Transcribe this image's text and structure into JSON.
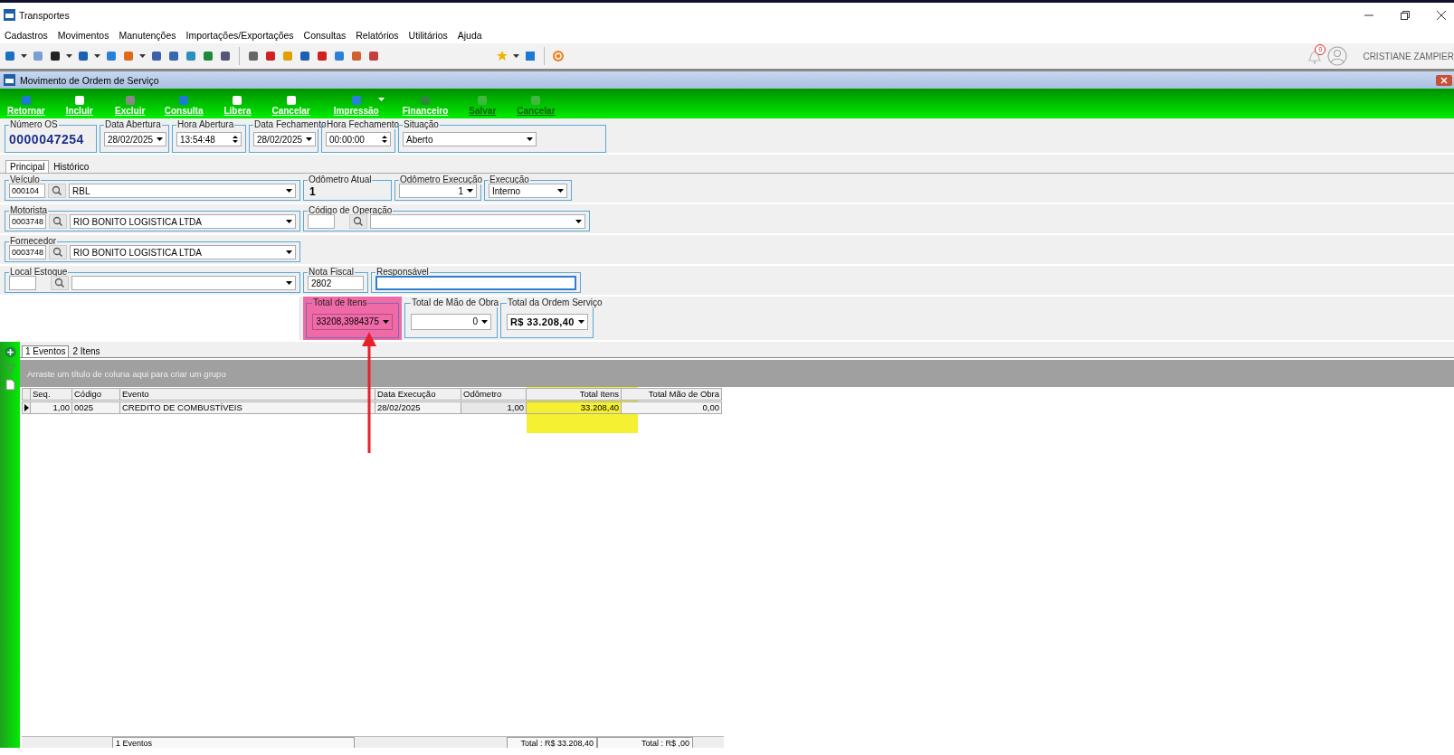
{
  "window": {
    "title": "Transportes"
  },
  "menu": [
    {
      "label": "Cadastros"
    },
    {
      "label": "Movimentos"
    },
    {
      "label": "Manutenções"
    },
    {
      "label": "Importações/Exportações"
    },
    {
      "label": "Consultas"
    },
    {
      "label": "Relatórios"
    },
    {
      "label": "Utilitários"
    },
    {
      "label": "Ajuda"
    }
  ],
  "user": {
    "name": "CRISTIANE ZAMPIER",
    "notifications": "0"
  },
  "form": {
    "title": "Movimento de Ordem de Serviço",
    "actions": [
      {
        "label": "Retornar",
        "disabled": false,
        "dropdown": false
      },
      {
        "label": "Incluir",
        "disabled": false,
        "dropdown": false
      },
      {
        "label": "Excluir",
        "disabled": false,
        "dropdown": false
      },
      {
        "label": "Consulta",
        "disabled": false,
        "dropdown": false
      },
      {
        "label": "Libera",
        "disabled": false,
        "dropdown": false
      },
      {
        "label": "Cancelar",
        "disabled": false,
        "dropdown": false
      },
      {
        "label": "Impressão",
        "disabled": false,
        "dropdown": true
      },
      {
        "label": "Financeiro",
        "disabled": false,
        "dropdown": false
      },
      {
        "label": "Salvar",
        "disabled": true,
        "dropdown": false
      },
      {
        "label": "Cancelar",
        "disabled": true,
        "dropdown": false
      }
    ],
    "header": [
      {
        "label": "Número OS",
        "value": "0000047254",
        "kind": "number"
      },
      {
        "label": "Data Abertura",
        "value": "28/02/2025",
        "kind": "date"
      },
      {
        "label": "Hora Abertura",
        "value": "13:54:48",
        "kind": "time"
      },
      {
        "label": "Data Fechamento",
        "value": "28/02/2025",
        "kind": "date"
      },
      {
        "label": "Hora Fechamento",
        "value": "00:00:00",
        "kind": "time"
      },
      {
        "label": "Situação",
        "value": "Aberto",
        "kind": "select"
      }
    ],
    "tabs": [
      {
        "label": "Principal",
        "selected": true
      },
      {
        "label": "Histórico",
        "selected": false
      }
    ],
    "veiculo": {
      "label": "Veículo",
      "code": "000104",
      "name": "RBL"
    },
    "odometro_atual": {
      "label": "Odômetro Atual",
      "value": "1"
    },
    "odometro_execucao": {
      "label": "Odômetro Execução",
      "value": "1"
    },
    "execucao": {
      "label": "Execução",
      "value": "Interno"
    },
    "motorista": {
      "label": "Motorista",
      "code": "0003748",
      "name": "RIO BONITO LOGISTICA LTDA"
    },
    "codigo_operacao": {
      "label": "Código de Operação"
    },
    "fornecedor": {
      "label": "Fornecedor",
      "code": "0003748",
      "name": "RIO BONITO LOGISTICA LTDA"
    },
    "local_estoque": {
      "label": "Local Estoque"
    },
    "nota_fiscal": {
      "label": "Nota Fiscal",
      "value": "2802"
    },
    "responsavel": {
      "label": "Responsável"
    },
    "totals": [
      {
        "label": "Total de Itens",
        "value": "33208,3984375",
        "kind": "plain"
      },
      {
        "label": "Total de Mão de Obra",
        "value": "0",
        "kind": "plain"
      },
      {
        "label": "Total da Ordem Serviço",
        "value": "R$ 33.208,40",
        "kind": "bold"
      }
    ],
    "grid_tabs": [
      {
        "label": "1 Eventos",
        "selected": true
      },
      {
        "label": "2 Itens",
        "selected": false
      }
    ],
    "group_panel": "Arraste um título de coluna aqui para criar um grupo",
    "columns": [
      {
        "label": "Seq."
      },
      {
        "label": "Código"
      },
      {
        "label": "Evento"
      },
      {
        "label": "Data Execução"
      },
      {
        "label": "Odômetro"
      },
      {
        "label": "Total Itens"
      },
      {
        "label": "Total Mão de Obra"
      }
    ],
    "rows": [
      {
        "cells": [
          "1,00",
          "0025",
          "CREDITO DE COMBUSTÍVEIS",
          "28/02/2025",
          "1,00",
          "33.208,40",
          "0,00"
        ],
        "selected": true
      }
    ],
    "footer": [
      "1 Eventos",
      "Total : R$ 33.208,40",
      "Total : R$ ,00"
    ]
  },
  "annotations": [
    {
      "kind": "highlight",
      "color": "#f06aa8"
    },
    {
      "kind": "highlight",
      "color": "#f5f032"
    },
    {
      "kind": "arrow",
      "color": "#e8202a"
    }
  ]
}
